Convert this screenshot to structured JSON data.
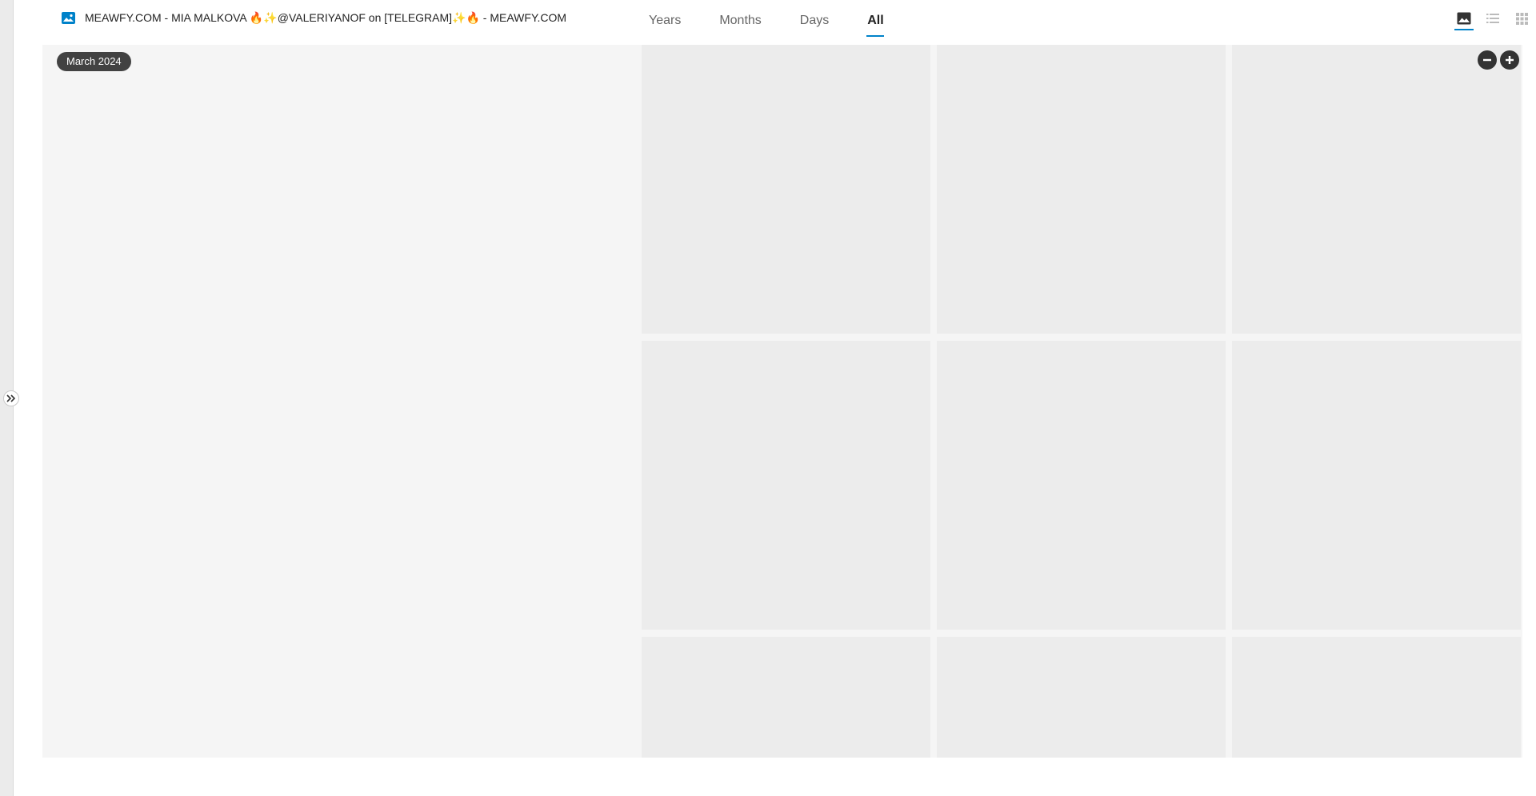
{
  "album": {
    "icon": "image-icon",
    "title": "MEAWFY.COM - MIA MALKOVA 🔥✨@VALERIYANOF on [TELEGRAM]✨🔥 - MEAWFY.COM"
  },
  "tabs": [
    {
      "label": "Years",
      "active": false
    },
    {
      "label": "Months",
      "active": false
    },
    {
      "label": "Days",
      "active": false
    },
    {
      "label": "All",
      "active": true
    }
  ],
  "view_modes": [
    {
      "icon": "photo-view-icon",
      "active": true
    },
    {
      "icon": "list-view-icon",
      "active": false
    },
    {
      "icon": "grid-view-icon",
      "active": false
    }
  ],
  "grid": {
    "section_label": "March 2024",
    "zoom_out_icon": "minus-icon",
    "zoom_in_icon": "plus-icon"
  },
  "sidebar": {
    "toggle_icon": "double-chevron-right-icon"
  },
  "colors": {
    "accent": "#0082c9",
    "chip_bg": "#424242",
    "placeholder": "#ececec"
  }
}
